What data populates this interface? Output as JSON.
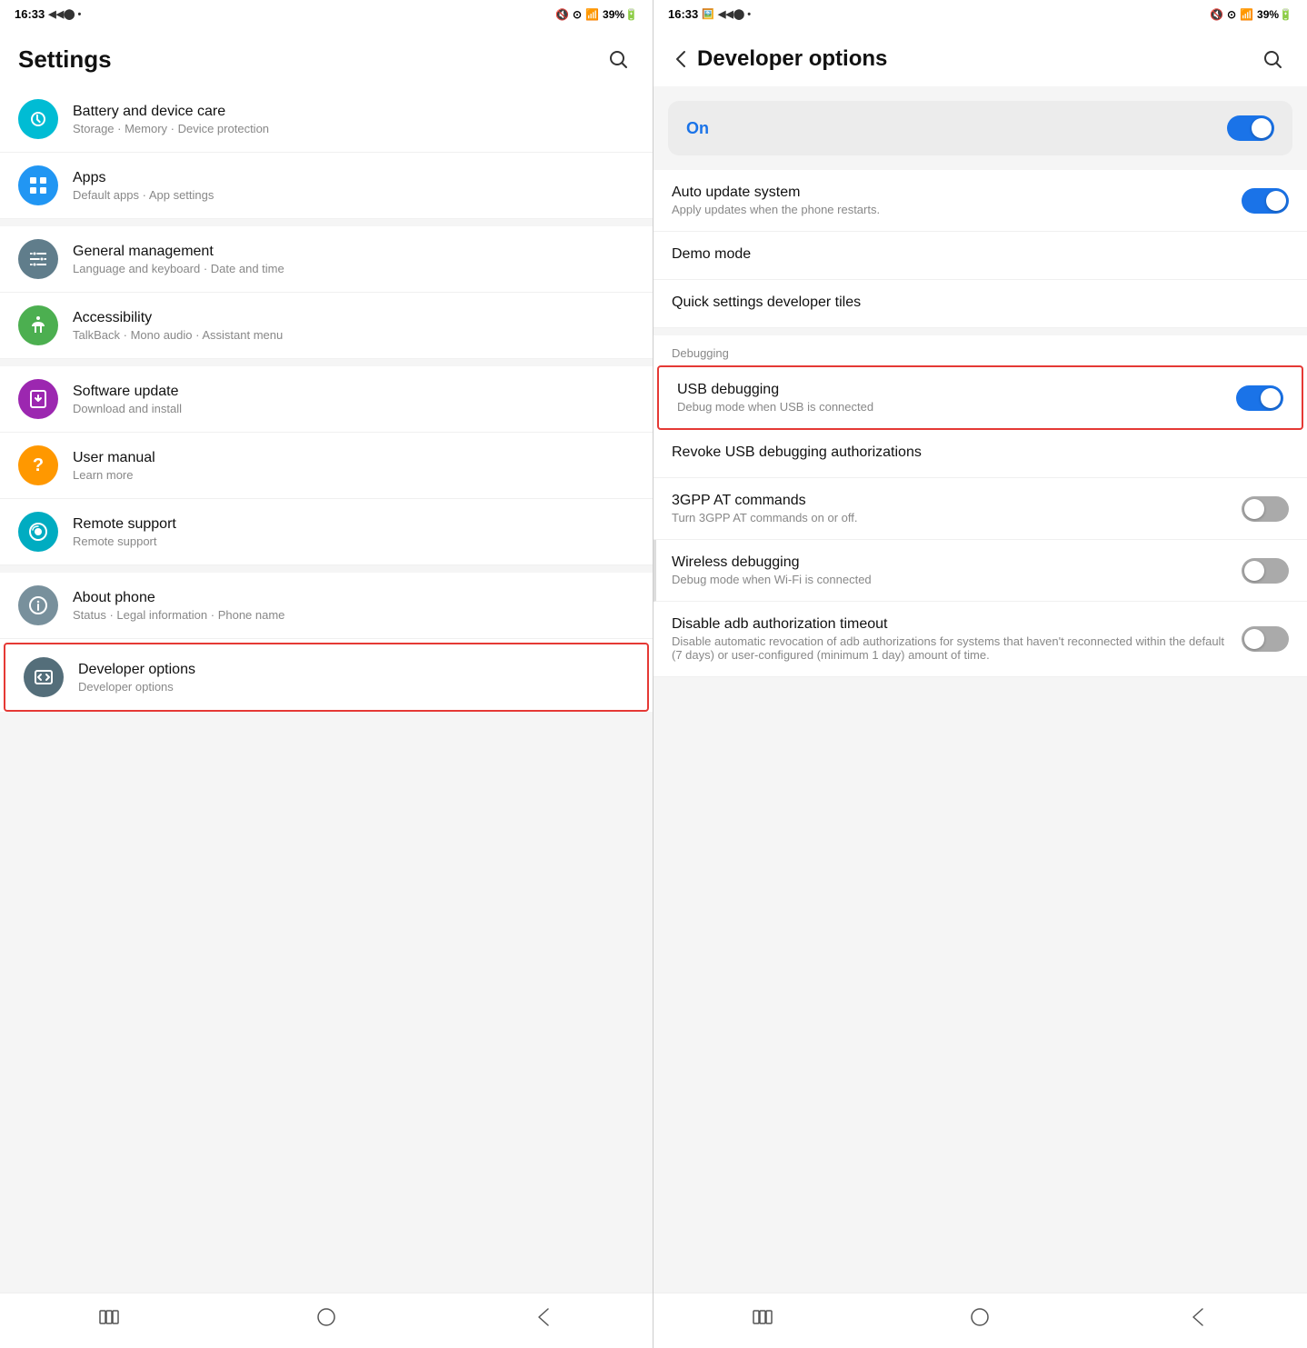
{
  "left_panel": {
    "status_bar": {
      "time": "16:33",
      "signal_icons": "◀◀◉ •",
      "right_icons": "🔇 ⊙ 📶 39%🔋"
    },
    "header": {
      "title": "Settings",
      "search_aria": "Search"
    },
    "settings_items": [
      {
        "id": "battery",
        "title": "Battery and device care",
        "subtitle": "Storage · Memory · Device protection",
        "icon_color": "teal",
        "icon_symbol": "🔄",
        "highlighted": false
      },
      {
        "id": "apps",
        "title": "Apps",
        "subtitle": "Default apps · App settings",
        "icon_color": "blue",
        "icon_symbol": "⊞",
        "highlighted": false
      },
      {
        "id": "general",
        "title": "General management",
        "subtitle": "Language and keyboard · Date and time",
        "icon_color": "gray",
        "icon_symbol": "☰",
        "highlighted": false
      },
      {
        "id": "accessibility",
        "title": "Accessibility",
        "subtitle": "TalkBack · Mono audio · Assistant menu",
        "icon_color": "green",
        "icon_symbol": "♿",
        "highlighted": false
      },
      {
        "id": "software",
        "title": "Software update",
        "subtitle": "Download and install",
        "icon_color": "purple",
        "icon_symbol": "↓",
        "highlighted": false
      },
      {
        "id": "usermanual",
        "title": "User manual",
        "subtitle": "Learn more",
        "icon_color": "orange",
        "icon_symbol": "?",
        "highlighted": false
      },
      {
        "id": "remote",
        "title": "Remote support",
        "subtitle": "Remote support",
        "icon_color": "cyan",
        "icon_symbol": "🎧",
        "highlighted": false
      },
      {
        "id": "about",
        "title": "About phone",
        "subtitle": "Status · Legal information · Phone name",
        "icon_color": "gray",
        "icon_symbol": "ℹ",
        "highlighted": false
      },
      {
        "id": "developer",
        "title": "Developer options",
        "subtitle": "Developer options",
        "icon_color": "dark-gray",
        "icon_symbol": "{}",
        "highlighted": true
      }
    ],
    "nav": {
      "back": "<",
      "home": "○",
      "recents": "|||"
    }
  },
  "right_panel": {
    "status_bar": {
      "time": "16:33",
      "right_icons": "🔇 ⊙ 📶 39%🔋"
    },
    "header": {
      "title": "Developer options",
      "back_label": "<",
      "search_aria": "Search"
    },
    "on_toggle": {
      "label": "On",
      "state": true
    },
    "sections": [
      {
        "label": "",
        "items": [
          {
            "id": "auto_update",
            "title": "Auto update system",
            "subtitle": "Apply updates when the phone restarts.",
            "has_toggle": true,
            "toggle_on": true,
            "highlighted": false
          },
          {
            "id": "demo_mode",
            "title": "Demo mode",
            "subtitle": "",
            "has_toggle": false,
            "highlighted": false
          },
          {
            "id": "quick_settings",
            "title": "Quick settings developer tiles",
            "subtitle": "",
            "has_toggle": false,
            "highlighted": false
          }
        ]
      },
      {
        "label": "Debugging",
        "items": [
          {
            "id": "usb_debugging",
            "title": "USB debugging",
            "subtitle": "Debug mode when USB is connected",
            "has_toggle": true,
            "toggle_on": true,
            "highlighted": true
          },
          {
            "id": "revoke_usb",
            "title": "Revoke USB debugging authorizations",
            "subtitle": "",
            "has_toggle": false,
            "highlighted": false
          },
          {
            "id": "3gpp",
            "title": "3GPP AT commands",
            "subtitle": "Turn 3GPP AT commands on or off.",
            "has_toggle": true,
            "toggle_on": false,
            "highlighted": false
          },
          {
            "id": "wireless_debug",
            "title": "Wireless debugging",
            "subtitle": "Debug mode when Wi-Fi is connected",
            "has_toggle": true,
            "toggle_on": false,
            "highlighted": false
          },
          {
            "id": "disable_adb",
            "title": "Disable adb authorization timeout",
            "subtitle": "Disable automatic revocation of adb authorizations for systems that haven't reconnected within the default (7 days) or user-configured (minimum 1 day) amount of time.",
            "has_toggle": true,
            "toggle_on": false,
            "highlighted": false
          }
        ]
      }
    ],
    "nav": {
      "back": "<",
      "home": "○",
      "recents": "|||"
    }
  }
}
